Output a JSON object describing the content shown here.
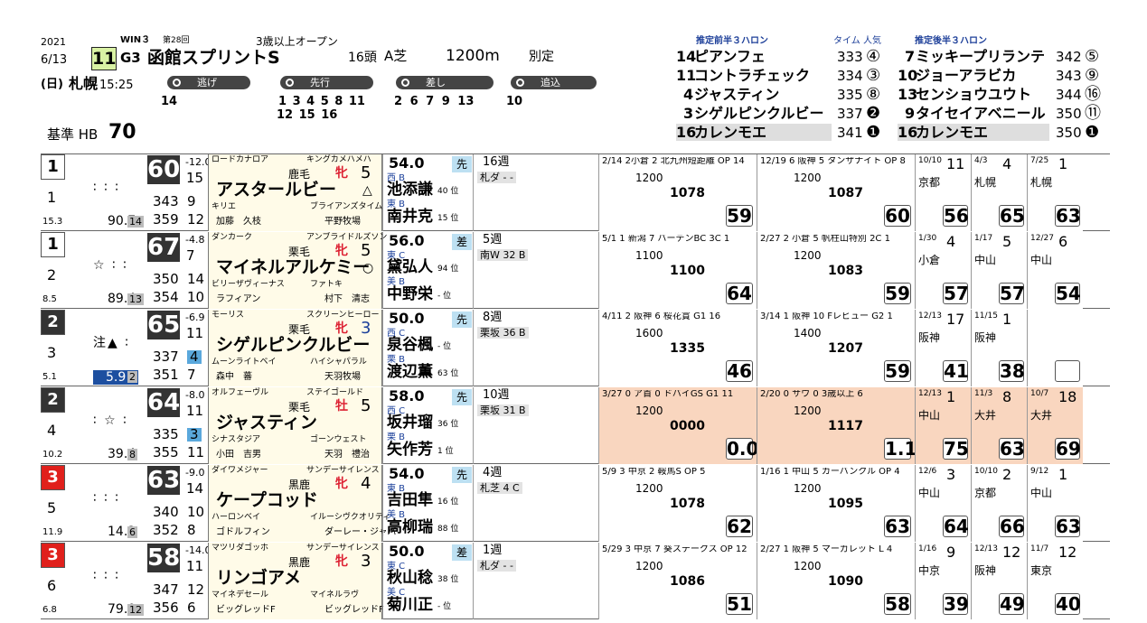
{
  "header": {
    "year": "2021",
    "date": "6/13",
    "day": "(日)",
    "venue": "札幌",
    "time": "15:25",
    "win_label": "WIN３",
    "kai": "第28回",
    "race_no": "11",
    "grade": "G3",
    "race_name": "函館スプリントS",
    "condition": "3歳以上オープン",
    "field": "16頭",
    "surface": "A芝",
    "distance": "1200m",
    "weight_rule": "別定",
    "base_label": "基準 HB",
    "base_value": "70",
    "styles": [
      "逃げ",
      "先行",
      "差し",
      "追込"
    ],
    "nige": "14",
    "senko_1": "1 3 4 5 8 11",
    "senko_2": "12 15 16",
    "sashi": "2 6 7 9 13",
    "oikomi": "10"
  },
  "ranking": {
    "front_title": "推定前半３ハロン",
    "back_title": "推定後半３ハロン",
    "time_label": "タイム 人気",
    "front": [
      {
        "no": "14",
        "name": "ピアンフェ",
        "time": "333",
        "pop": "④"
      },
      {
        "no": "11",
        "name": "コントラチェック",
        "time": "334",
        "pop": "③"
      },
      {
        "no": "4",
        "name": "ジャスティン",
        "time": "335",
        "pop": "⑧"
      },
      {
        "no": "3",
        "name": "シゲルピンクルビー",
        "time": "337",
        "pop": "❷"
      },
      {
        "no": "16",
        "name": "カレンモエ",
        "time": "341",
        "pop": "❶"
      }
    ],
    "back": [
      {
        "no": "7",
        "name": "ミッキープリランテ",
        "time": "342",
        "pop": "⑤"
      },
      {
        "no": "10",
        "name": "ジョーアラビカ",
        "time": "343",
        "pop": "⑨"
      },
      {
        "no": "13",
        "name": "センショウユウト",
        "time": "344",
        "pop": "⑯"
      },
      {
        "no": "9",
        "name": "タイセイアベニール",
        "time": "350",
        "pop": "⑪"
      },
      {
        "no": "16",
        "name": "カレンモエ",
        "time": "350",
        "pop": "❶"
      }
    ]
  },
  "horses": [
    {
      "gate": "1",
      "num": "1",
      "marks": "∶ ∶ ∶",
      "odds_a": "15.3",
      "odds_b": "90.7",
      "pop": "14",
      "idx": "60",
      "diff": "-12.0",
      "sub": [
        [
          "343",
          "9"
        ],
        [
          "359",
          "12"
        ],
        [
          "15",
          ""
        ]
      ],
      "sire": "ロードカナロア",
      "dam_sire_top": "キングカメハメハ",
      "color": "鹿毛",
      "sex": "牝",
      "age": "5",
      "name": "アスタールビー",
      "mark": "△",
      "dam": "キリエ",
      "dam_sire": "ブライアンズタイム",
      "trainer": "加藤　久枝",
      "breeder": "平野牧場",
      "weight": "54.0",
      "j_region": "西 B",
      "jockey": "池添謙",
      "j_rate": "40 位",
      "t_region": "東 B",
      "trainer2": "南井克",
      "t_rate": "15 位",
      "pace": "先",
      "rest": "16週",
      "cond": "札ダ - -",
      "r1": {
        "txt": "2/14 2小倉 2 北九州短距離 OP 14",
        "t": "1200",
        "w": "1078",
        "r": "59"
      },
      "r2": {
        "txt": "12/19 6 阪神 5 タンザナイト OP 8",
        "t": "1200",
        "w": "1087",
        "r": "60"
      },
      "last": [
        [
          "10/10",
          "11",
          "京都",
          "56"
        ],
        [
          "4/3",
          "4",
          "札幌",
          "65"
        ],
        [
          "7/25",
          "1",
          "札幌",
          "63"
        ]
      ]
    },
    {
      "gate": "1",
      "num": "2",
      "marks": "☆ ∶ ∶",
      "odds_a": "8.5",
      "odds_b": "89.4",
      "pop": "13",
      "idx": "67",
      "diff": "-4.8",
      "sub": [
        [
          "350",
          "14"
        ],
        [
          "354",
          "10"
        ],
        [
          "7",
          ""
        ]
      ],
      "sire": "ダンカーク",
      "dam_sire_top": "アンブライドルズソン",
      "color": "栗毛",
      "sex": "牝",
      "age": "5",
      "name": "マイネルアルケミー",
      "mark": "○",
      "dam": "ビリーザヴィーナス",
      "dam_sire": "ファトキ",
      "trainer": "ラフィアン",
      "breeder": "村下　清志",
      "weight": "56.0",
      "j_region": "東 C",
      "jockey": "黛弘人",
      "j_rate": "94 位",
      "t_region": "美 B",
      "trainer2": "中野栄",
      "t_rate": "- 位",
      "pace": "差",
      "rest": "5週",
      "cond": "南W 32 B",
      "r1": {
        "txt": "5/1 1 新潟 7 バーデンBC 3C 1",
        "t": "1100",
        "w": "1100",
        "r": "64"
      },
      "r2": {
        "txt": "2/27 2 小倉 5 帆柱山特別 2C 1",
        "t": "1200",
        "w": "1083",
        "r": "59"
      },
      "last": [
        [
          "1/30",
          "4",
          "小倉",
          "57"
        ],
        [
          "1/17",
          "5",
          "中山",
          "57"
        ],
        [
          "12/27",
          "6",
          "中山",
          "54"
        ]
      ]
    },
    {
      "gate": "2",
      "num": "3",
      "marks": "注▲ ∶",
      "odds_a": "5.1",
      "odds_b": "5.9",
      "pop": "2",
      "idx": "65",
      "diff": "-6.9",
      "sub": [
        [
          "337",
          "4"
        ],
        [
          "351",
          "7"
        ],
        [
          "11",
          ""
        ]
      ],
      "sire": "モーリス",
      "dam_sire_top": "スクリーンヒーロー",
      "color": "栗毛",
      "sex": "牝",
      "age": "3",
      "name": "シゲルピンクルビー",
      "mark": "",
      "dam": "ムーンライトベイ",
      "dam_sire": "ハイシャパラル",
      "trainer": "森中　蕃",
      "breeder": "天羽牧場",
      "weight": "50.0",
      "j_region": "西 C",
      "jockey": "泉谷楓",
      "j_rate": "- 位",
      "t_region": "栗 B",
      "trainer2": "渡辺薫",
      "t_rate": "63 位",
      "pace": "先",
      "rest": "8週",
      "cond": "栗坂 36 B",
      "r1": {
        "txt": "4/11 2 阪神 6 桜花賞 G1 16",
        "t": "1600",
        "w": "1335",
        "r": "46"
      },
      "r2": {
        "txt": "3/14 1 阪神 10 Fレビュー G2 1",
        "t": "1400",
        "w": "1207",
        "r": "59"
      },
      "last": [
        [
          "12/13",
          "17",
          "阪神",
          "41"
        ],
        [
          "11/15",
          "1",
          "阪神",
          "38"
        ],
        [
          "",
          "",
          "",
          " "
        ]
      ]
    },
    {
      "gate": "2",
      "num": "4",
      "marks": "∶ ☆ ∶",
      "odds_a": "10.2",
      "odds_b": "39.4",
      "pop": "8",
      "idx": "64",
      "diff": "-8.0",
      "sub": [
        [
          "335",
          "3"
        ],
        [
          "355",
          "11"
        ],
        [
          "11",
          ""
        ]
      ],
      "sire": "オルフェーヴル",
      "dam_sire_top": "ステイゴールド",
      "color": "栗毛",
      "sex": "牡",
      "age": "5",
      "name": "ジャスティン",
      "mark": "",
      "dam": "シナスタジア",
      "dam_sire": "ゴーンウェスト",
      "trainer": "小田　吉男",
      "breeder": "天羽　禮治",
      "weight": "58.0",
      "j_region": "西 C",
      "jockey": "坂井瑠",
      "j_rate": "36 位",
      "t_region": "栗 B",
      "trainer2": "矢作芳",
      "t_rate": "1 位",
      "pace": "先",
      "rest": "10週",
      "cond": "栗坂 31 B",
      "r1": {
        "txt": "3/27 0 ア首 0 ドバイGS G1 11",
        "t": "1200",
        "w": "0000",
        "r": "0.0"
      },
      "r2": {
        "txt": "2/20 0 サウ 0 3歳以上 6",
        "t": "1200",
        "w": "1117",
        "r": "1.1"
      },
      "last": [
        [
          "12/13",
          "1",
          "中山",
          "75"
        ],
        [
          "11/3",
          "8",
          "大井",
          "63"
        ],
        [
          "10/7",
          "18",
          "大井",
          "69"
        ]
      ]
    },
    {
      "gate": "3",
      "num": "5",
      "marks": "∶ ∶ ∶",
      "odds_a": "11.9",
      "odds_b": "14.2",
      "pop": "6",
      "idx": "63",
      "diff": "-9.0",
      "sub": [
        [
          "340",
          "10"
        ],
        [
          "352",
          "8"
        ],
        [
          "14",
          ""
        ]
      ],
      "sire": "ダイワメジャー",
      "dam_sire_top": "サンデーサイレンス",
      "color": "黒鹿",
      "sex": "牝",
      "age": "4",
      "name": "ケープコッド",
      "mark": "",
      "dam": "ハーロンベイ",
      "dam_sire": "イルーシヴクオリティ",
      "trainer": "ゴドルフィン",
      "breeder": "ダーレー・ジャパ",
      "weight": "54.0",
      "j_region": "東 B",
      "jockey": "吉田隼",
      "j_rate": "16 位",
      "t_region": "美 B",
      "trainer2": "高柳瑞",
      "t_rate": "88 位",
      "pace": "先",
      "rest": "4週",
      "cond": "札芝 4 C",
      "r1": {
        "txt": "5/9 3 中京 2 鞍馬S OP 5",
        "t": "1200",
        "w": "1078",
        "r": "62"
      },
      "r2": {
        "txt": "1/16 1 中山 5 カーバンクル OP 4",
        "t": "1200",
        "w": "1095",
        "r": "63"
      },
      "last": [
        [
          "12/6",
          "3",
          "中山",
          "64"
        ],
        [
          "10/10",
          "2",
          "京都",
          "66"
        ],
        [
          "9/12",
          "1",
          "中山",
          "63"
        ]
      ]
    },
    {
      "gate": "3",
      "num": "6",
      "marks": "∶ ∶ ∶",
      "odds_a": "6.8",
      "odds_b": "79.0",
      "pop": "12",
      "idx": "58",
      "diff": "-14.0",
      "sub": [
        [
          "347",
          "12"
        ],
        [
          "356",
          "6"
        ],
        [
          "11",
          ""
        ]
      ],
      "sire": "マツリダゴッホ",
      "dam_sire_top": "サンデーサイレンス",
      "color": "黒鹿",
      "sex": "牝",
      "age": "3",
      "name": "リンゴアメ",
      "mark": "",
      "dam": "マイネデセール",
      "dam_sire": "マイネルラヴ",
      "trainer": "ビッグレッドF",
      "breeder": "ビッグレッドF",
      "weight": "50.0",
      "j_region": "東 C",
      "jockey": "秋山稔",
      "j_rate": "38 位",
      "t_region": "美 C",
      "trainer2": "菊川正",
      "t_rate": "- 位",
      "pace": "差",
      "rest": "1週",
      "cond": "札ダ - -",
      "r1": {
        "txt": "5/29 3 中京 7 葵ステークス OP 12",
        "t": "1200",
        "w": "1086",
        "r": "51"
      },
      "r2": {
        "txt": "2/27 1 阪神 5 マーガレット L 4",
        "t": "1200",
        "w": "1090",
        "r": "58"
      },
      "last": [
        [
          "1/16",
          "9",
          "中京",
          "39"
        ],
        [
          "12/13",
          "12",
          "阪神",
          "49"
        ],
        [
          "11/7",
          "12",
          "東京",
          "40"
        ]
      ]
    }
  ]
}
